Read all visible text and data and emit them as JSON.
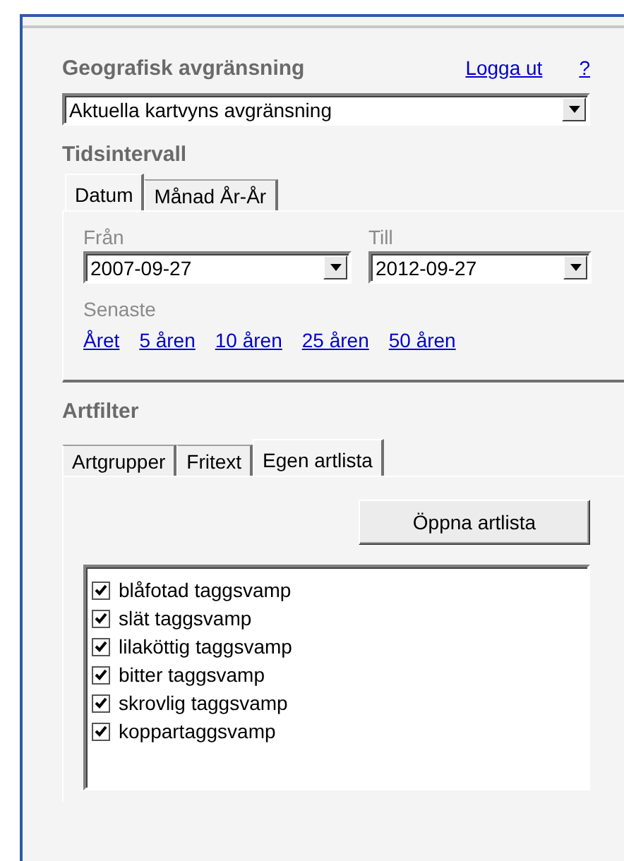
{
  "geo": {
    "title": "Geografisk avgränsning",
    "links": [
      "Logga ut",
      "?"
    ],
    "dropdown": {
      "value": "Aktuella kartvyns avgränsning"
    }
  },
  "time": {
    "title": "Tidsintervall",
    "tabs": [
      {
        "label": "Datum",
        "selected": true
      },
      {
        "label": "Månad År-År",
        "selected": false
      }
    ],
    "from": {
      "label": "Från",
      "value": "2007-09-27"
    },
    "to": {
      "label": "Till",
      "value": "2012-09-27"
    },
    "recent_label": "Senaste",
    "recent_links": [
      "Året",
      "5 åren",
      "10 åren",
      "25 åren",
      "50 åren"
    ]
  },
  "species": {
    "title": "Artfilter",
    "tabs": [
      {
        "label": "Artgrupper",
        "selected": false
      },
      {
        "label": "Fritext",
        "selected": false
      },
      {
        "label": "Egen artlista",
        "selected": true
      }
    ],
    "button": "Öppna artlista",
    "list": [
      {
        "label": "blåfotad taggsvamp",
        "checked": true
      },
      {
        "label": "slät taggsvamp",
        "checked": true
      },
      {
        "label": "lilaköttig taggsvamp",
        "checked": true
      },
      {
        "label": "bitter taggsvamp",
        "checked": true
      },
      {
        "label": "skrovlig taggsvamp",
        "checked": true
      },
      {
        "label": "koppartaggsvamp",
        "checked": true
      }
    ]
  }
}
